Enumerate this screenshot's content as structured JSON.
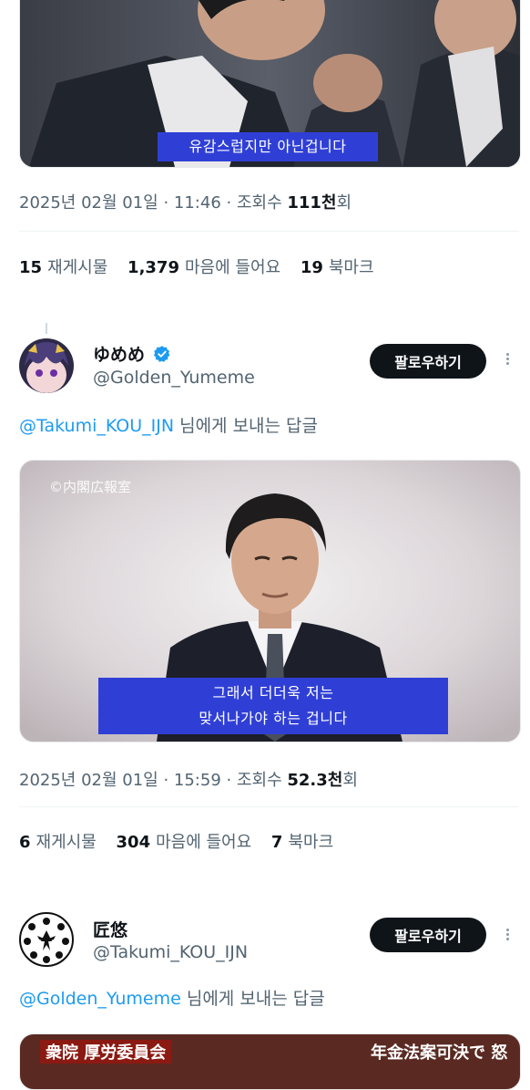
{
  "tweet1": {
    "subtitle": "유감스럽지만 아닌겁니다",
    "date": "2025년 02월 01일 · 11:46 · ",
    "views_label": "조회수 ",
    "views_count": "111천",
    "views_suffix": "회",
    "reposts_count": "15",
    "reposts_label": "재게시물",
    "likes_count": "1,379",
    "likes_label": "마음에 들어요",
    "bookmarks_count": "19",
    "bookmarks_label": "북마크"
  },
  "tweet2": {
    "display_name": "ゆめめ",
    "handle": "@Golden_Yumeme",
    "follow_label": "팔로우하기",
    "reply_to_handle": "@Takumi_KOU_IJN",
    "reply_to_suffix": " 님에게 보내는 답글",
    "image_watermark": "©内閣広報室",
    "subtitle_line1": "그래서 더더욱 저는",
    "subtitle_line2": "맞서나가야 하는 겁니다",
    "date": "2025년 02월 01일 · 15:59 · ",
    "views_label": "조회수 ",
    "views_count": "52.3천",
    "views_suffix": "회",
    "reposts_count": "6",
    "reposts_label": "재게시물",
    "likes_count": "304",
    "likes_label": "마음에 들어요",
    "bookmarks_count": "7",
    "bookmarks_label": "북마크"
  },
  "tweet3": {
    "display_name": "匠悠",
    "handle": "@Takumi_KOU_IJN",
    "follow_label": "팔로우하기",
    "reply_to_handle": "@Golden_Yumeme",
    "reply_to_suffix": " 님에게 보내는 답글",
    "image_caption_left": "衆院 厚労委員会",
    "image_caption_right": "年金法案可決で 怒"
  },
  "colors": {
    "accent_blue": "#1d9bf0",
    "subtitle_bg": "#2f3fd6",
    "button_bg": "#0f1419",
    "muted_text": "#536471"
  }
}
